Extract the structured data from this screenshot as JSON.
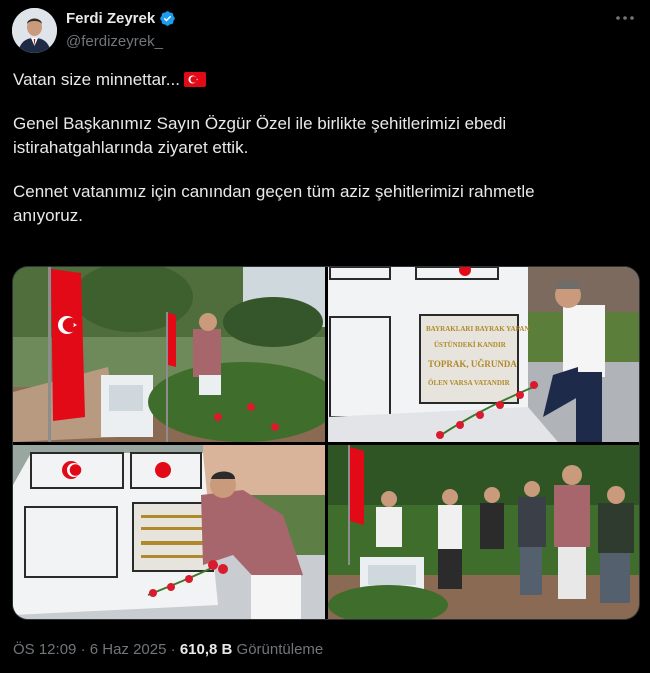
{
  "author": {
    "name": "Ferdi Zeyrek",
    "handle": "@ferdizeyrek_"
  },
  "tweet": {
    "line1": "Vatan size minnettar...",
    "paragraph2": "Genel Başkanımız Sayın Özgür Özel ile birlikte şehitlerimizi ebedi\nistirahatgahlarında ziyaret ettik.",
    "paragraph3": "Cennet vatanımız için canından geçen tüm aziz şehitlerimizi rahmetle\nanıyoruz."
  },
  "memorial_inscription": {
    "line1": "BAYRAKLARI BAYRAK YAPAN",
    "line2": "ÜSTÜNDEKİ KANDIR",
    "line3": "TOPRAK, UĞRUNDA",
    "line4": "ÖLEN VARSA VATANDIR"
  },
  "meta": {
    "time": "ÖS 12:09",
    "separator1": "·",
    "date": "6 Haz 2025",
    "separator2": "·",
    "views_count": "610,8 B",
    "views_label": "Görüntüleme"
  },
  "colors": {
    "background": "#000000",
    "text": "#e7e9ea",
    "secondary_text": "#71767b",
    "verified_blue": "#1d9bf0",
    "flag_red": "#e30a17"
  }
}
